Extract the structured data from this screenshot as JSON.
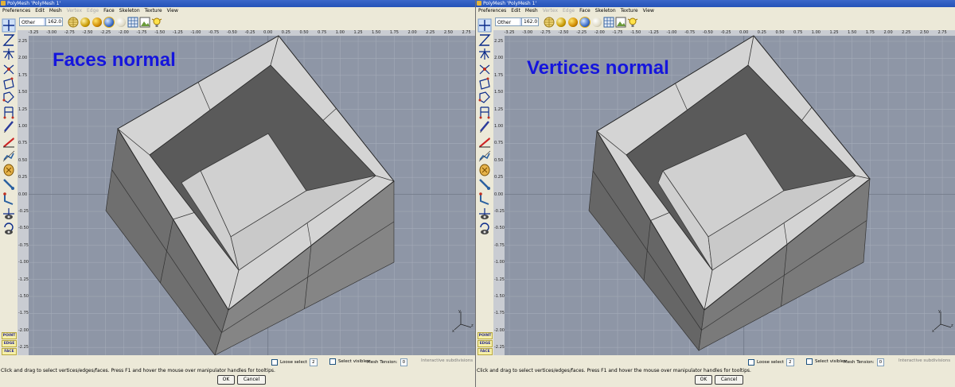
{
  "window_title": "PolyMesh 'PolyMesh 1'",
  "menu": [
    "Preferences",
    "Edit",
    "Mesh",
    "Vertex",
    "Edge",
    "Face",
    "Skeleton",
    "Texture",
    "View"
  ],
  "menu_disabled": [
    "Vertex",
    "Edge"
  ],
  "toolbar": {
    "view_select": "Other",
    "zoom_value": "162.0"
  },
  "ruler_x": [
    "-3.25",
    "-3.00",
    "-2.75",
    "-2.50",
    "-2.25",
    "-2.00",
    "-1.75",
    "-1.50",
    "-1.25",
    "-1.00",
    "-0.75",
    "-0.50",
    "-0.25",
    "0.00",
    "0.25",
    "0.50",
    "0.75",
    "1.00",
    "1.25",
    "1.50",
    "1.75",
    "2.00",
    "2.25",
    "2.50",
    "2.75",
    "3.00"
  ],
  "ruler_y": [
    "2.25",
    "2.00",
    "1.75",
    "1.50",
    "1.25",
    "1.00",
    "0.75",
    "0.50",
    "0.25",
    "0.00",
    "-0.25",
    "-0.50",
    "-0.75",
    "-1.00",
    "-1.25",
    "-1.50",
    "-1.75",
    "-2.00",
    "-2.25"
  ],
  "mode_buttons": [
    "POINT",
    "EDGE",
    "FACE"
  ],
  "panes": {
    "left": {
      "overlay_label": "Faces normal"
    },
    "right": {
      "overlay_label": "Vertices normal"
    }
  },
  "options": {
    "loose_select": "Loose select",
    "loose_select_value": "2",
    "select_visibles": "Select visibles",
    "mesh_tension": "Mesh Tension:",
    "mesh_tension_value": "0",
    "interactive_subdivisions": "Interactive subdivisions"
  },
  "status_text": "Click and drag to select vertices/edges/faces. Press F1 and hover the mouse over manipulator handles for tooltips.",
  "buttons": {
    "ok": "OK",
    "cancel": "Cancel"
  },
  "gizmo_axes": {
    "x": "x",
    "y": "y",
    "z": "z"
  },
  "colors": {
    "viewport_bg": "#8e96a6",
    "label_blue": "#1515dd",
    "mesh_top": "#d4d4d4",
    "mesh_side": "#6e6e6e"
  }
}
